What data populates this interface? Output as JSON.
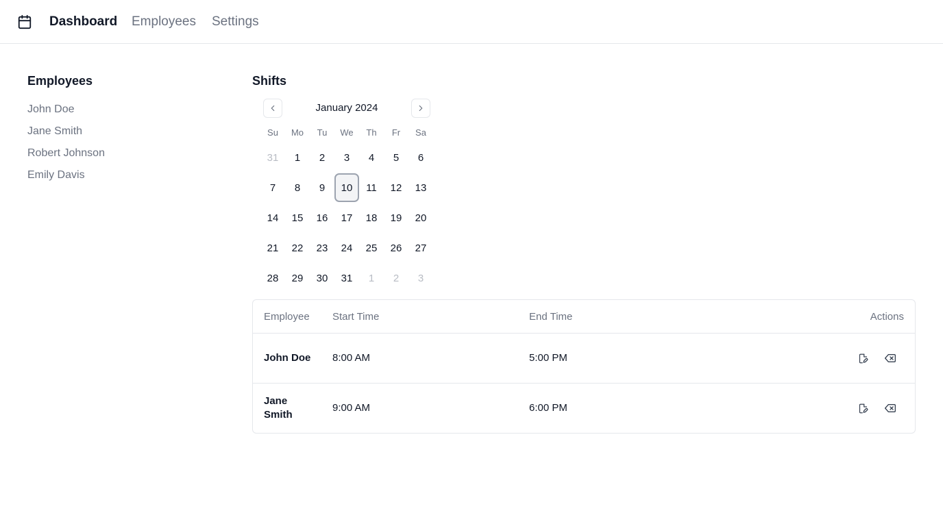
{
  "header": {
    "logo_icon": "calendar-icon",
    "nav": [
      {
        "label": "Dashboard",
        "active": true
      },
      {
        "label": "Employees",
        "active": false
      },
      {
        "label": "Settings",
        "active": false
      }
    ]
  },
  "sidebar": {
    "title": "Employees",
    "employees": [
      "John Doe",
      "Jane Smith",
      "Robert Johnson",
      "Emily Davis"
    ]
  },
  "shifts": {
    "title": "Shifts",
    "calendar": {
      "month_label": "January 2024",
      "prev_icon": "chevron-left-icon",
      "next_icon": "chevron-right-icon",
      "weekdays": [
        "Su",
        "Mo",
        "Tu",
        "We",
        "Th",
        "Fr",
        "Sa"
      ],
      "days": [
        {
          "label": "31",
          "outside": true
        },
        {
          "label": "1"
        },
        {
          "label": "2"
        },
        {
          "label": "3"
        },
        {
          "label": "4"
        },
        {
          "label": "5"
        },
        {
          "label": "6"
        },
        {
          "label": "7"
        },
        {
          "label": "8"
        },
        {
          "label": "9"
        },
        {
          "label": "10",
          "selected": true
        },
        {
          "label": "11"
        },
        {
          "label": "12"
        },
        {
          "label": "13"
        },
        {
          "label": "14"
        },
        {
          "label": "15"
        },
        {
          "label": "16"
        },
        {
          "label": "17"
        },
        {
          "label": "18"
        },
        {
          "label": "19"
        },
        {
          "label": "20"
        },
        {
          "label": "21"
        },
        {
          "label": "22"
        },
        {
          "label": "23"
        },
        {
          "label": "24"
        },
        {
          "label": "25"
        },
        {
          "label": "26"
        },
        {
          "label": "27"
        },
        {
          "label": "28"
        },
        {
          "label": "29"
        },
        {
          "label": "30"
        },
        {
          "label": "31"
        },
        {
          "label": "1",
          "outside": true
        },
        {
          "label": "2",
          "outside": true
        },
        {
          "label": "3",
          "outside": true
        }
      ]
    },
    "table": {
      "headers": {
        "employee": "Employee",
        "start": "Start Time",
        "end": "End Time",
        "actions": "Actions"
      },
      "rows": [
        {
          "employee": "John Doe",
          "start": "8:00 AM",
          "end": "5:00 PM",
          "edit_icon": "edit-file-icon",
          "delete_icon": "delete-icon"
        },
        {
          "employee": "Jane Smith",
          "start": "9:00 AM",
          "end": "6:00 PM",
          "edit_icon": "edit-file-icon",
          "delete_icon": "delete-icon"
        }
      ]
    }
  },
  "colors": {
    "text": "#111827",
    "muted": "#6b7280",
    "border": "#e5e7eb",
    "selected_bg": "#f3f4f6"
  }
}
